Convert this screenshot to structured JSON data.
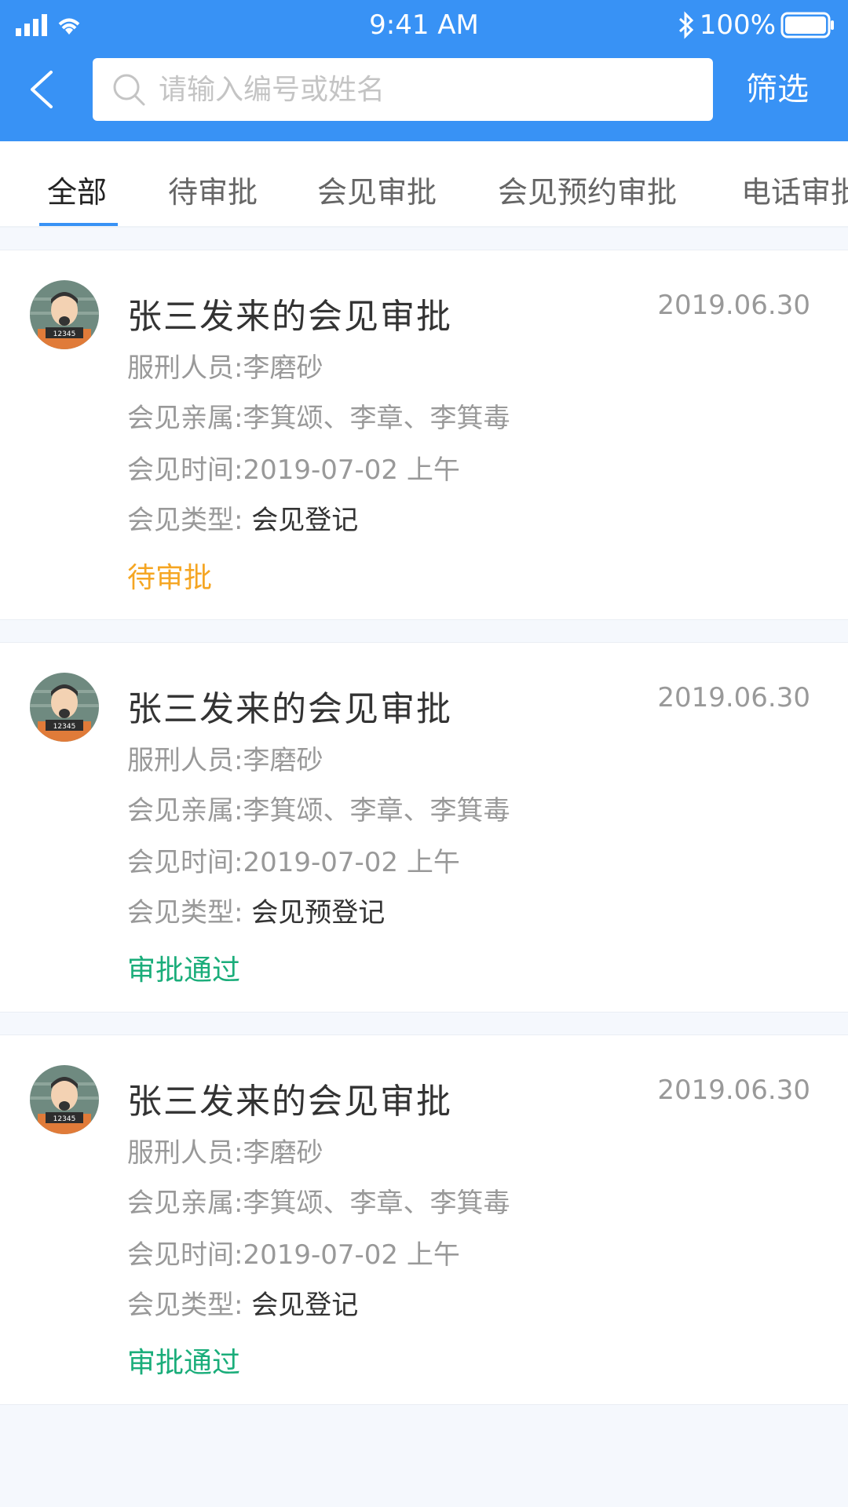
{
  "status_bar": {
    "time": "9:41 AM",
    "battery": "100%"
  },
  "header": {
    "search_placeholder": "请输入编号或姓名",
    "filter_label": "筛选"
  },
  "tabs": [
    {
      "label": "全部"
    },
    {
      "label": "待审批"
    },
    {
      "label": "会见审批"
    },
    {
      "label": "会见预约审批"
    },
    {
      "label": "电话审批"
    }
  ],
  "cards": [
    {
      "title": "张三发来的会见审批",
      "date": "2019.06.30",
      "prisoner": "服刑人员:李磨砂",
      "relatives": "会见亲属:李箕颂、李章、李箕毒",
      "time": "会见时间:2019-07-02   上午",
      "type_label": "会见类型:",
      "type_value": "会见登记",
      "status": "待审批",
      "status_color": "#f5a623"
    },
    {
      "title": "张三发来的会见审批",
      "date": "2019.06.30",
      "prisoner": "服刑人员:李磨砂",
      "relatives": "会见亲属:李箕颂、李章、李箕毒",
      "time": "会见时间:2019-07-02   上午",
      "type_label": "会见类型:",
      "type_value": "会见预登记",
      "status": "审批通过",
      "status_color": "#1aad7a"
    },
    {
      "title": "张三发来的会见审批",
      "date": "2019.06.30",
      "prisoner": "服刑人员:李磨砂",
      "relatives": "会见亲属:李箕颂、李章、李箕毒",
      "time": "会见时间:2019-07-02   上午",
      "type_label": "会见类型:",
      "type_value": "会见登记",
      "status": "审批通过",
      "status_color": "#1aad7a"
    }
  ],
  "colors": {
    "primary": "#3892f5",
    "pending": "#f5a623",
    "approved": "#1aad7a"
  }
}
